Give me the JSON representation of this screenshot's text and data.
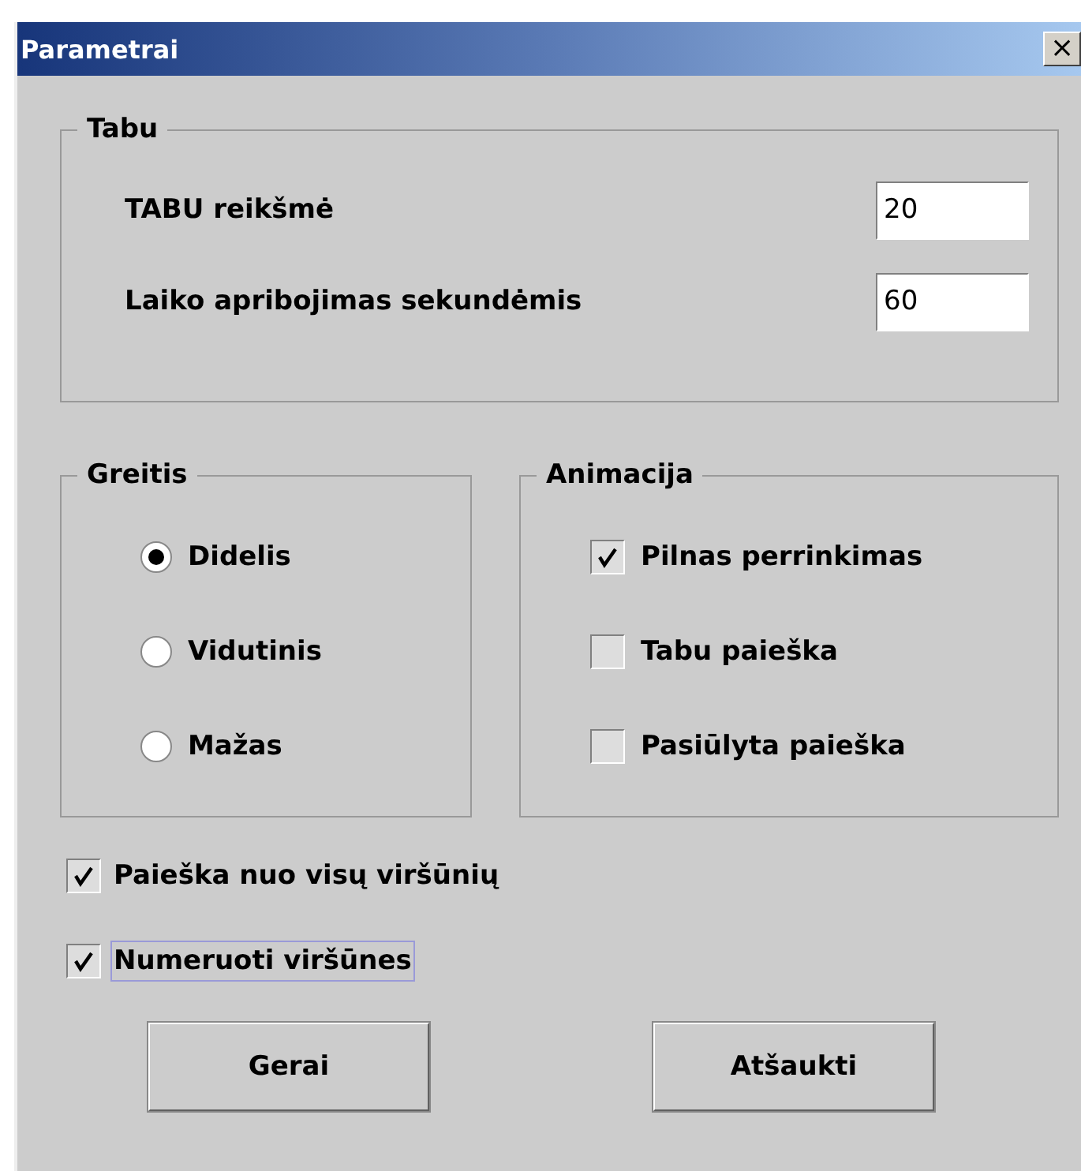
{
  "window": {
    "title": "Parametrai",
    "close": "×"
  },
  "tabu": {
    "title": "Tabu",
    "fields": [
      {
        "label": "TABU reikšmė",
        "value": "20"
      },
      {
        "label": "Laiko apribojimas sekundėmis",
        "value": "60"
      }
    ]
  },
  "speed": {
    "title": "Greitis",
    "options": [
      {
        "label": "Didelis",
        "selected": true
      },
      {
        "label": "Vidutinis",
        "selected": false
      },
      {
        "label": "Mažas",
        "selected": false
      }
    ]
  },
  "animation": {
    "title": "Animacija",
    "options": [
      {
        "label": "Pilnas perrinkimas",
        "checked": true
      },
      {
        "label": "Tabu paieška",
        "checked": false
      },
      {
        "label": "Pasiūlyta paieška",
        "checked": false
      }
    ]
  },
  "options": [
    {
      "label": "Paieška nuo visų viršūnių",
      "checked": true,
      "focused": false
    },
    {
      "label": "Numeruoti viršūnes",
      "checked": true,
      "focused": true
    }
  ],
  "buttons": [
    "Gerai",
    "Atšaukti"
  ]
}
